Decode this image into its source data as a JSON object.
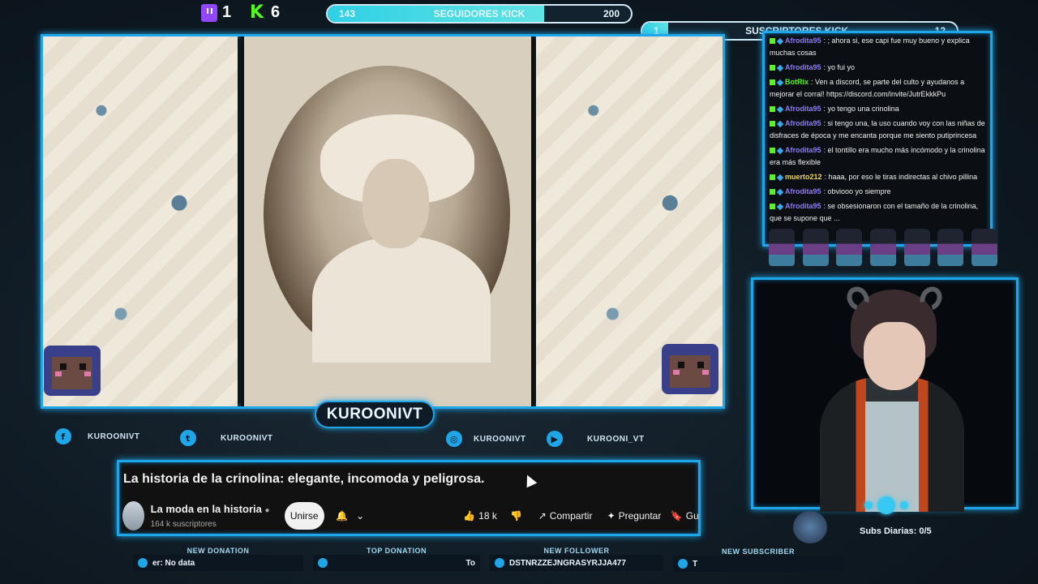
{
  "top": {
    "twitch_count": "1",
    "kick_count": "6",
    "followers_bar": {
      "current": "143",
      "label": "SEGUIDORES KICK",
      "goal": "200",
      "progress": 0.715
    },
    "subs_bar": {
      "current": "1",
      "label": "SUSCRIPTORES KICK",
      "goal": "12",
      "progress": 0.083
    }
  },
  "streamer_name": "KUROONIVT",
  "socials": {
    "facebook": "KUROONIVT",
    "twitter": "KUROONIVT",
    "instagram": "KUROONIVT",
    "youtube": "KUROONI_VT"
  },
  "video": {
    "title": "La historia de la crinolina: elegante, incomoda y peligrosa.",
    "channel": "La moda en la historia",
    "subscribers": "164 k suscriptores",
    "join": "Unirse",
    "likes": "18 k",
    "share": "Compartir",
    "ask": "Preguntar",
    "save_partial": "Gu"
  },
  "chat": [
    {
      "badges": [
        "k",
        "d"
      ],
      "user": "Afrodita95",
      "color": "#8e7cf0",
      "text": ": ; ahora si, ese capi fue muy bueno y explica muchas cosas"
    },
    {
      "badges": [
        "k",
        "d"
      ],
      "user": "Afrodita95",
      "color": "#8e7cf0",
      "text": ": yo fui yo"
    },
    {
      "badges": [
        "k",
        "d"
      ],
      "user": "BotRix",
      "color": "#53fc18",
      "text": ": Ven a discord, se parte del culto y ayudanos a mejorar el corral! https://discord.com/invite/JutrEkkkPu"
    },
    {
      "badges": [
        "k",
        "d"
      ],
      "user": "Afrodita95",
      "color": "#8e7cf0",
      "text": ": yo tengo una crinolina"
    },
    {
      "badges": [
        "k",
        "d"
      ],
      "user": "Afrodita95",
      "color": "#8e7cf0",
      "text": ": si tengo una, la uso cuando voy con las niñas de disfraces de época y me encanta porque me siento putiprincesa"
    },
    {
      "badges": [
        "k",
        "d"
      ],
      "user": "Afrodita95",
      "color": "#8e7cf0",
      "text": ": el tontillo era mucho más incómodo y la crinolina era más flexible"
    },
    {
      "badges": [
        "k",
        "d"
      ],
      "user": "muerto212",
      "color": "#f0d35a",
      "text": ": haaa, por eso le tiras indirectas al chivo pillina"
    },
    {
      "badges": [
        "k",
        "d"
      ],
      "user": "Afrodita95",
      "color": "#8e7cf0",
      "text": ": obviooo yo siempre"
    },
    {
      "badges": [
        "k",
        "d"
      ],
      "user": "Afrodita95",
      "color": "#8e7cf0",
      "text": ": se obsesionaron con el tamaño de la crinolina, que se supone que ..."
    }
  ],
  "subs_daily": "Subs Diarias:  0/5",
  "alerts": {
    "new_donation": {
      "label": "NEW DONATION",
      "value": "er: No data"
    },
    "top_donation": {
      "label": "TOP DONATION",
      "value": "To"
    },
    "new_follower": {
      "label": "NEW FOLLOWER",
      "value": "DSTNRZZEJNGRASYRJJA477"
    },
    "new_subscriber": {
      "label": "NEW SUBSCRIBER",
      "value": "T"
    }
  },
  "colors": {
    "accent": "#1fa6e8",
    "kick_green": "#53fc18",
    "twitch_purple": "#9146ff"
  }
}
